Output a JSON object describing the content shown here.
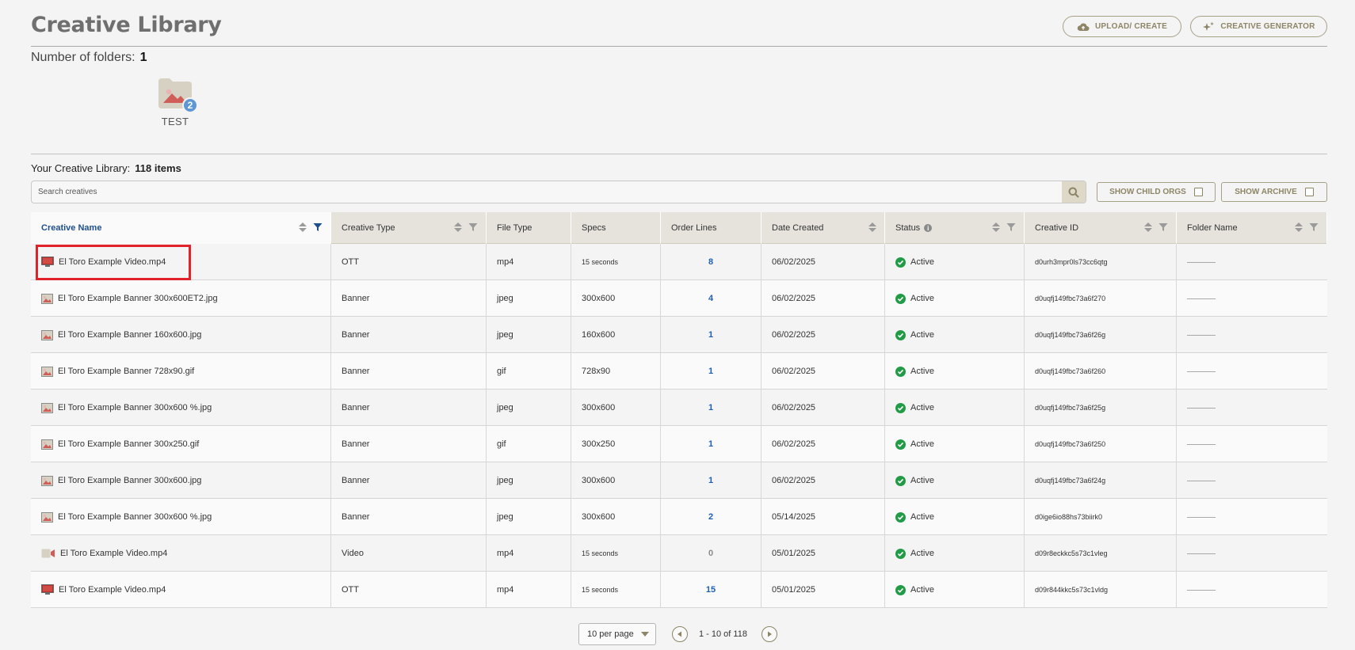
{
  "header": {
    "title": "Creative Library",
    "upload_label": "UPLOAD/ CREATE",
    "generator_label": "CREATIVE GENERATOR"
  },
  "folders": {
    "count_label": "Number of folders:",
    "count": "1",
    "items": [
      {
        "label": "TEST",
        "badge": "2"
      }
    ]
  },
  "library": {
    "label": "Your Creative Library:",
    "count": "118 items",
    "search_placeholder": "Search creatives",
    "show_child_orgs": "SHOW CHILD ORGS",
    "show_archive": "SHOW ARCHIVE"
  },
  "table": {
    "headers": [
      "Creative Name",
      "Creative Type",
      "File Type",
      "Specs",
      "Order Lines",
      "Date Created",
      "Status",
      "Creative ID",
      "Folder Name"
    ],
    "rows": [
      {
        "icon": "ott",
        "name": "El Toro Example Video.mp4",
        "type": "OTT",
        "file": "mp4",
        "specs": "15 seconds",
        "lines": "8",
        "date": "06/02/2025",
        "status": "Active",
        "id": "d0urh3mpr0ls73cc6qtg"
      },
      {
        "icon": "image",
        "name": "El Toro Example Banner 300x600ET2.jpg",
        "type": "Banner",
        "file": "jpeg",
        "specs": "300x600",
        "lines": "4",
        "date": "06/02/2025",
        "status": "Active",
        "id": "d0uqfj149fbc73a6f270"
      },
      {
        "icon": "image",
        "name": "El Toro Example Banner 160x600.jpg",
        "type": "Banner",
        "file": "jpeg",
        "specs": "160x600",
        "lines": "1",
        "date": "06/02/2025",
        "status": "Active",
        "id": "d0uqfj149fbc73a6f26g"
      },
      {
        "icon": "image",
        "name": "El Toro Example Banner 728x90.gif",
        "type": "Banner",
        "file": "gif",
        "specs": "728x90",
        "lines": "1",
        "date": "06/02/2025",
        "status": "Active",
        "id": "d0uqfj149fbc73a6f260"
      },
      {
        "icon": "image",
        "name": "El Toro Example Banner 300x600 %.jpg",
        "type": "Banner",
        "file": "jpeg",
        "specs": "300x600",
        "lines": "1",
        "date": "06/02/2025",
        "status": "Active",
        "id": "d0uqfj149fbc73a6f25g"
      },
      {
        "icon": "image",
        "name": "El Toro Example Banner 300x250.gif",
        "type": "Banner",
        "file": "gif",
        "specs": "300x250",
        "lines": "1",
        "date": "06/02/2025",
        "status": "Active",
        "id": "d0uqfj149fbc73a6f250"
      },
      {
        "icon": "image",
        "name": "El Toro Example Banner 300x600.jpg",
        "type": "Banner",
        "file": "jpeg",
        "specs": "300x600",
        "lines": "1",
        "date": "06/02/2025",
        "status": "Active",
        "id": "d0uqfj149fbc73a6f24g"
      },
      {
        "icon": "image",
        "name": "El Toro Example Banner 300x600 %.jpg",
        "type": "Banner",
        "file": "jpeg",
        "specs": "300x600",
        "lines": "2",
        "date": "05/14/2025",
        "status": "Active",
        "id": "d0ige6io88hs73biirk0"
      },
      {
        "icon": "video",
        "name": "El Toro Example Video.mp4",
        "type": "Video",
        "file": "mp4",
        "specs": "15 seconds",
        "lines": "0",
        "date": "05/01/2025",
        "status": "Active",
        "id": "d09r8eckkc5s73c1vleg"
      },
      {
        "icon": "ott",
        "name": "El Toro Example Video.mp4",
        "type": "OTT",
        "file": "mp4",
        "specs": "15 seconds",
        "lines": "15",
        "date": "05/01/2025",
        "status": "Active",
        "id": "d09r844kkc5s73c1vldg"
      }
    ]
  },
  "pagination": {
    "per_page": "10 per page",
    "range": "1 - 10 of 118"
  },
  "colors": {
    "accent": "#8d8566",
    "link": "#1f5fb3",
    "active_status": "#229b47",
    "highlight": "#e1222a"
  }
}
